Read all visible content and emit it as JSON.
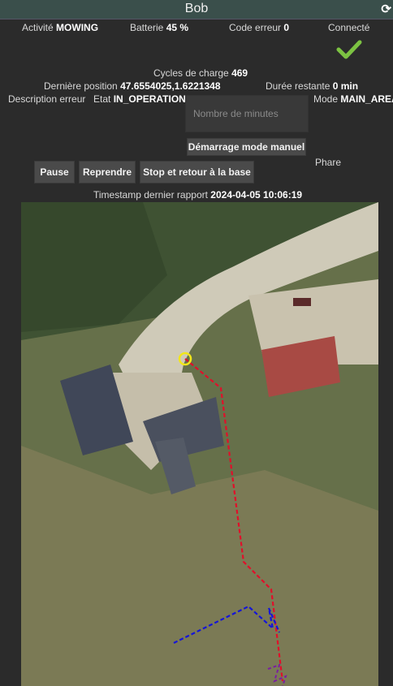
{
  "window": {
    "title": "Bob",
    "refresh_icon": "refresh-icon"
  },
  "status": {
    "activity_label": "Activité",
    "activity_value": "MOWING",
    "battery_label": "Batterie",
    "battery_value": "45 %",
    "error_code_label": "Code erreur",
    "error_code_value": "0",
    "connected_label": "Connecté",
    "connected_icon": "checkmark-icon"
  },
  "info": {
    "cycles_label": "Cycles de charge",
    "cycles_value": "469",
    "position_label": "Dernière position",
    "position_value": "47.6554025,1.6221348",
    "remaining_label": "Durée restante",
    "remaining_value": "0 min",
    "error_desc_label": "Description erreur",
    "state_label": "Etat",
    "state_value": "IN_OPERATION",
    "mode_label": "Mode",
    "mode_value": "MAIN_AREA",
    "timestamp_label": "Timestamp dernier rapport",
    "timestamp_value": "2024-04-05 10:06:19",
    "phare_label": "Phare"
  },
  "controls": {
    "minutes_placeholder": "Nombre de minutes",
    "manual_start_label": "Démarrage mode manuel",
    "pause_label": "Pause",
    "resume_label": "Reprendre",
    "stop_label": "Stop et retour à la base"
  },
  "colors": {
    "accent_green": "#7cc242",
    "path_red": "#e0102a",
    "path_blue": "#1515d8",
    "marker_yellow": "#f2e61a"
  }
}
